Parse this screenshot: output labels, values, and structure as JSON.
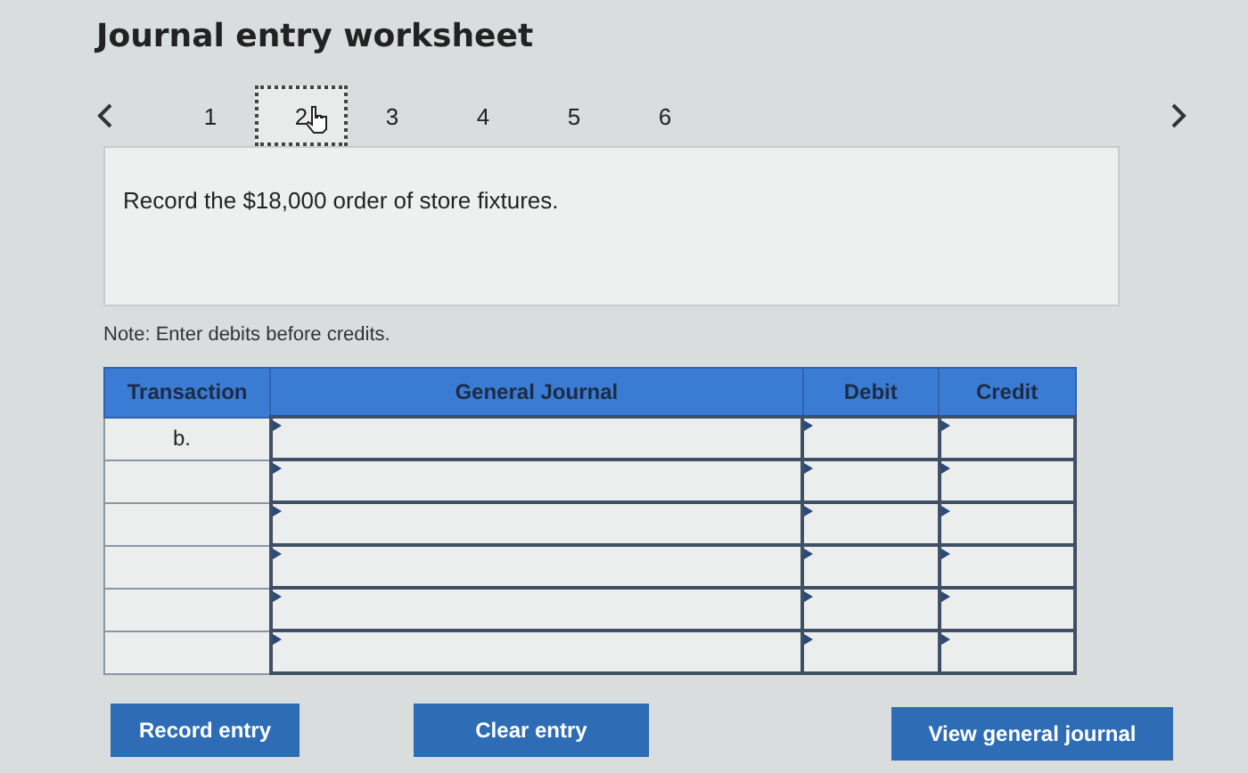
{
  "title": "Journal entry worksheet",
  "pages": [
    {
      "label": "1",
      "selected": false
    },
    {
      "label": "2",
      "selected": true
    },
    {
      "label": "3",
      "selected": false
    },
    {
      "label": "4",
      "selected": false
    },
    {
      "label": "5",
      "selected": false
    },
    {
      "label": "6",
      "selected": false
    }
  ],
  "prompt": "Record the $18,000 order of store fixtures.",
  "note": "Note: Enter debits before credits.",
  "table": {
    "columns": [
      "Transaction",
      "General Journal",
      "Debit",
      "Credit"
    ],
    "rows": [
      {
        "transaction": "b."
      },
      {},
      {},
      {},
      {},
      {}
    ]
  },
  "buttons": [
    "Record entry",
    "Clear entry",
    "View general journal"
  ]
}
